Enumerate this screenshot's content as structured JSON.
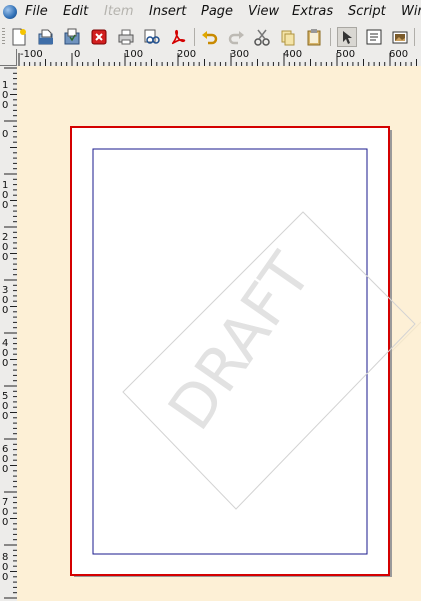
{
  "menu": {
    "items": [
      {
        "label": "File",
        "enabled": true
      },
      {
        "label": "Edit",
        "enabled": true
      },
      {
        "label": "Item",
        "enabled": false
      },
      {
        "label": "Insert",
        "enabled": true
      },
      {
        "label": "Page",
        "enabled": true
      },
      {
        "label": "View",
        "enabled": true
      },
      {
        "label": "Extras",
        "enabled": true
      },
      {
        "label": "Script",
        "enabled": true
      },
      {
        "label": "Win",
        "enabled": true
      }
    ]
  },
  "toolbar": {
    "icons": [
      "new-document-icon",
      "open-icon",
      "save-icon",
      "close-document-icon",
      "print-icon",
      "preflight-icon",
      "export-pdf-icon",
      "undo-icon",
      "redo-icon",
      "cut-icon",
      "copy-icon",
      "paste-icon",
      "select-icon",
      "text-frame-icon",
      "image-frame-icon"
    ],
    "active": "select-icon"
  },
  "rulers": {
    "horizontal_labels": [
      "-100",
      "0",
      "100",
      "200",
      "300",
      "400",
      "500",
      "600"
    ],
    "vertical_labels": [
      "100",
      "0",
      "100",
      "200",
      "300",
      "400",
      "500",
      "600",
      "700",
      "800"
    ]
  },
  "canvas": {
    "watermark": "DRAFT",
    "colors": {
      "background": "#fdf0d6",
      "page_border": "#d40000",
      "margin_guides": "#1a1a8c",
      "watermark": "#e2e2e2"
    }
  }
}
